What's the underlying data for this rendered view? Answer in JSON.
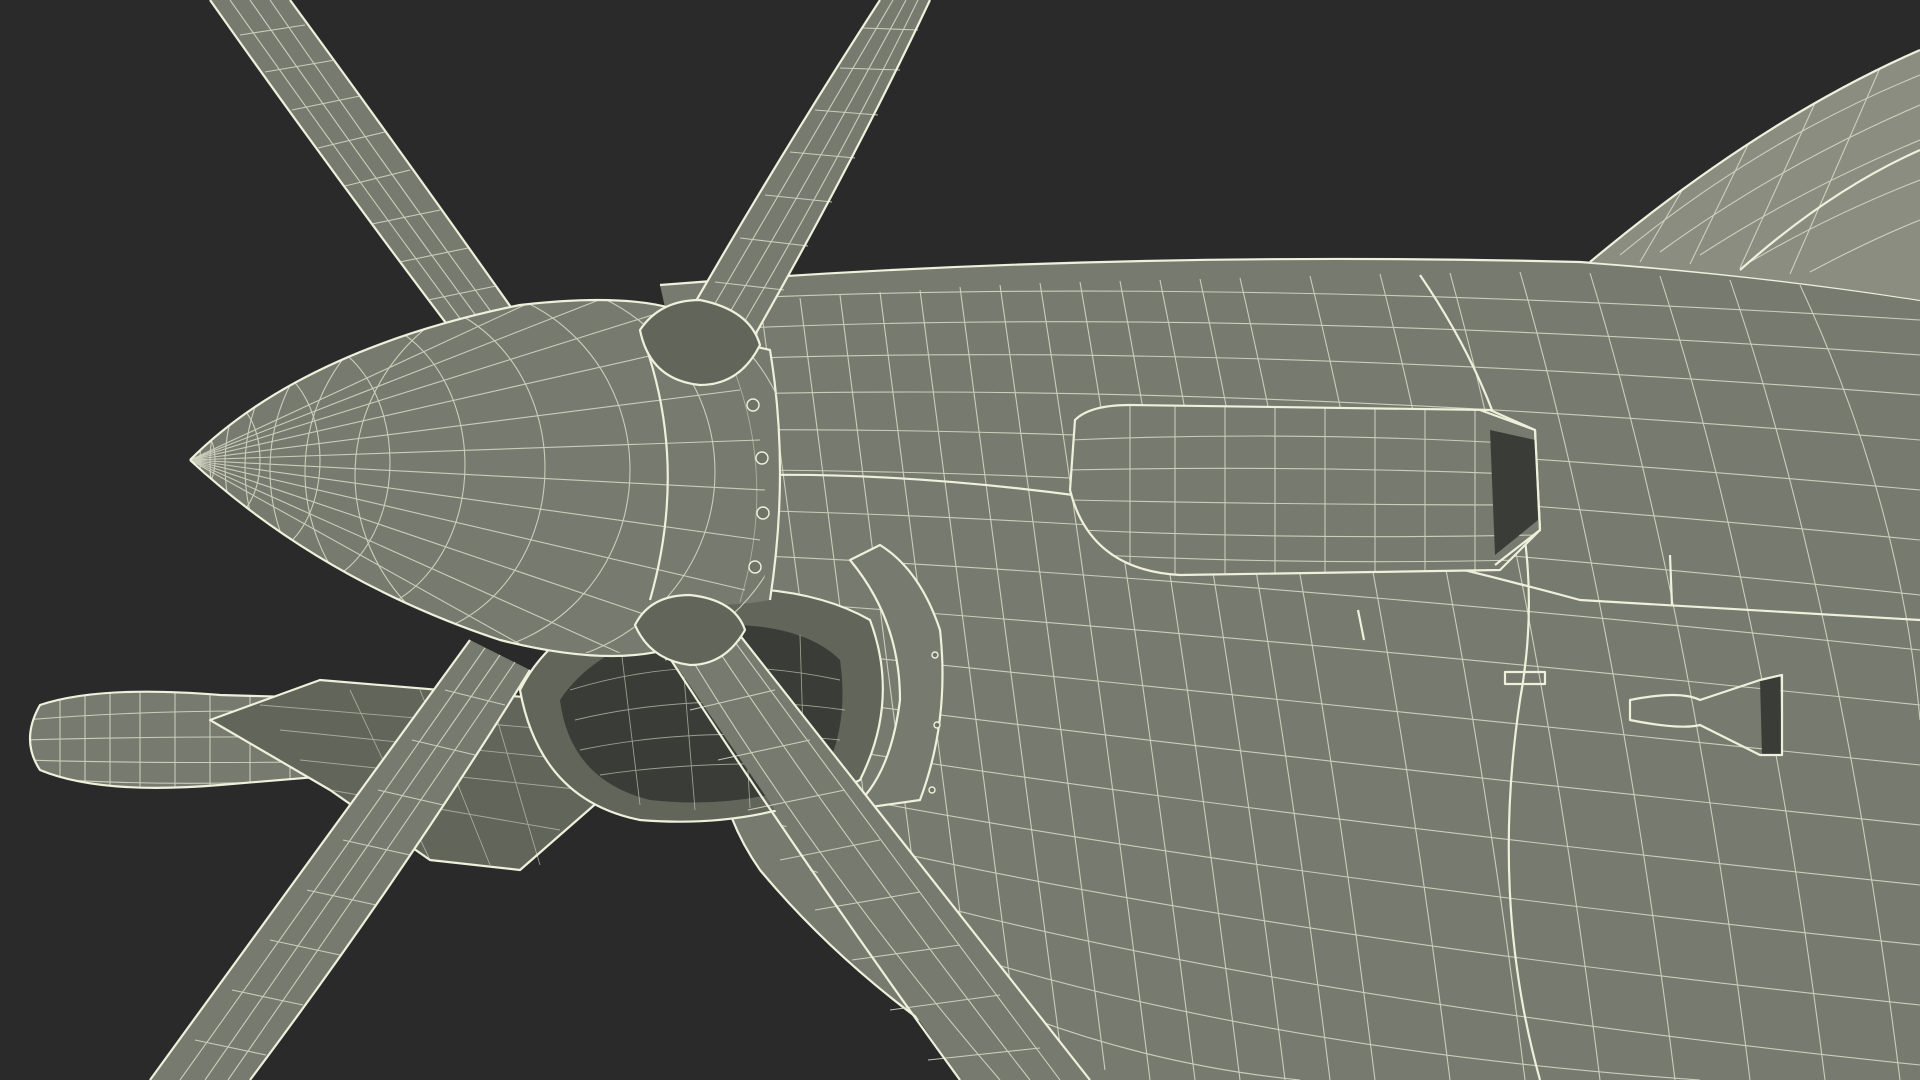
{
  "scene": {
    "background_color": "#2a2a2a",
    "model_surface_color": "#777a6e",
    "wireframe_color": "#e6e8d4",
    "render_style": "wireframe-on-shaded"
  }
}
